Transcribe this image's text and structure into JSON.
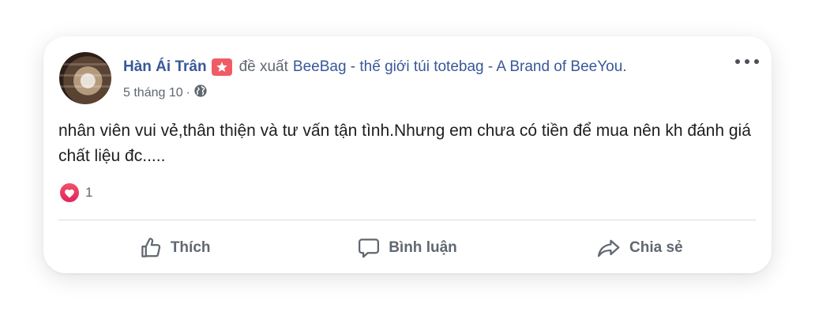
{
  "post": {
    "author": "Hàn Ái Trân",
    "recommends_text": "đề xuất",
    "page_name": "BeeBag - thế giới túi totebag - A Brand of BeeYou.",
    "date": "5 tháng 10",
    "separator": "·",
    "text": "nhân viên vui vẻ,thân thiện và tư vấn tận tình.Nhưng em chưa có tiền để mua nên kh đánh giá chất liệu đc.....",
    "reaction_count": "1",
    "reaction_icon": "heart-icon"
  },
  "actions": {
    "like": "Thích",
    "comment": "Bình luận",
    "share": "Chia sẻ"
  },
  "colors": {
    "link": "#385898",
    "muted": "#606770",
    "recommend_badge": "#f05c66",
    "love_reaction": "#e0245e"
  }
}
